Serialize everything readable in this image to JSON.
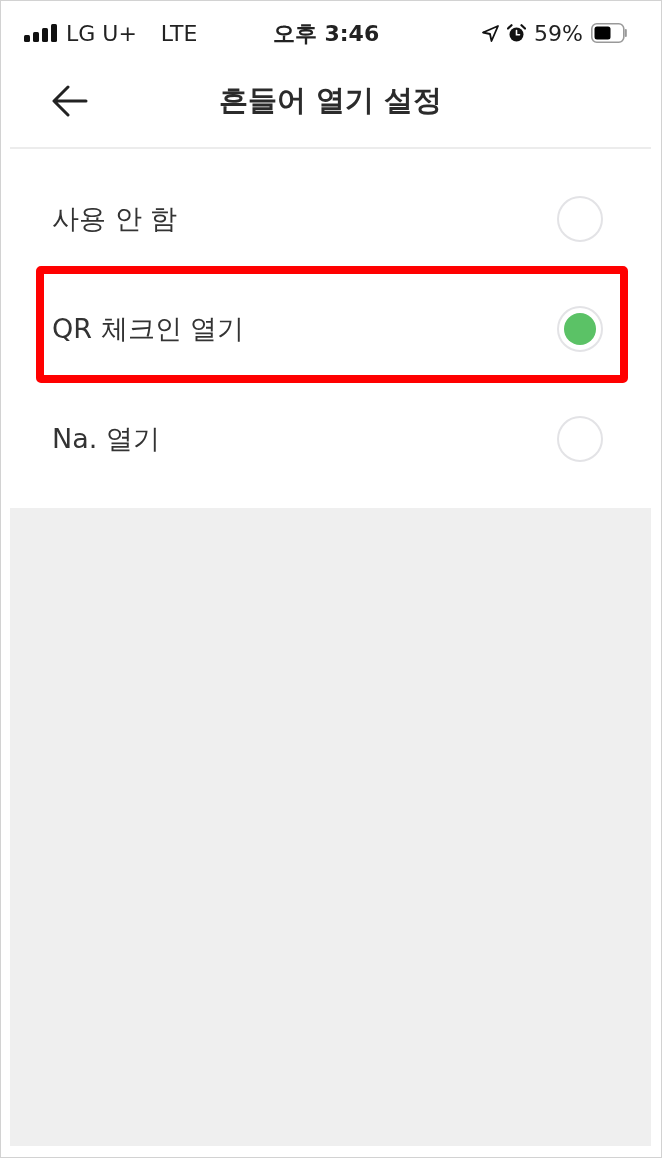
{
  "status_bar": {
    "carrier": "LG U+",
    "network": "LTE",
    "time": "오후 3:46",
    "battery": "59%"
  },
  "header": {
    "title": "흔들어 열기 설정"
  },
  "options": [
    {
      "label": "사용 안 함",
      "selected": false,
      "highlighted": false
    },
    {
      "label": "QR 체크인 열기",
      "selected": true,
      "highlighted": true
    },
    {
      "label": "Na. 열기",
      "selected": false,
      "highlighted": false
    }
  ]
}
